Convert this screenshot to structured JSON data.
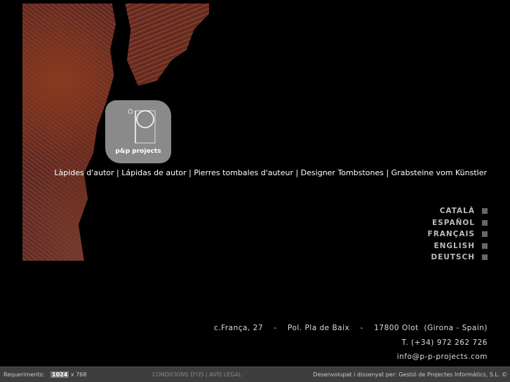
{
  "logo": {
    "text": "p&p projects"
  },
  "tagline": "Làpides d'autor | Lápidas de autor | Pierres tombales d'auteur | Designer Tombstones | Grabsteine vom Künstler",
  "languages": [
    "CATALÀ",
    "ESPAÑOL",
    "FRANÇAIS",
    "ENGLISH",
    "DEUTSCH"
  ],
  "address": {
    "line1": "c.França, 27    -    Pol. Pla de Baix    -    17800 Olot  (Girona - Spain)",
    "phone": "T. (+34) 972 262 726",
    "email": "info@p-p-projects.com"
  },
  "footer": {
    "req_label": "Requeriments:",
    "res_w": "1024",
    "res_x": "x",
    "res_h": "768",
    "legal": "CONDICIONS D'ÚS | AVÍS LEGAL",
    "credits": "Desenvolupat i dissenyat per: Gestió de Projectes Informàtics, S.L. ©"
  }
}
